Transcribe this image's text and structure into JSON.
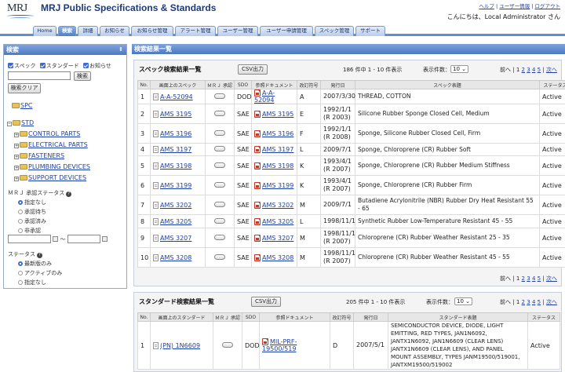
{
  "app": {
    "logo_text": "MRJ",
    "title": "MRJ Public Specifications & Standards"
  },
  "header": {
    "links": [
      "ヘルプ",
      "ユーザー情報",
      "ログアウト"
    ],
    "separator": "|",
    "greeting": "こんにちは、Local Administrator さん"
  },
  "tabs": [
    {
      "label": "Home",
      "active": false
    },
    {
      "label": "検索",
      "active": true
    },
    {
      "label": "詳細",
      "active": false
    },
    {
      "label": "お知らせ",
      "active": false
    },
    {
      "label": "お知らせ管理",
      "active": false
    },
    {
      "label": "アラート管理",
      "active": false
    },
    {
      "label": "ユーザー管理",
      "active": false
    },
    {
      "label": "ユーザー申請管理",
      "active": false
    },
    {
      "label": "スペック管理",
      "active": false
    },
    {
      "label": "サポート",
      "active": false
    }
  ],
  "sidebar": {
    "title": "検索",
    "collapse_glyph": "⇕",
    "filters": {
      "spec": "スペック",
      "standard": "スタンダード",
      "notice": "お知らせ"
    },
    "search_button": "検索",
    "clear_button": "検索クリア",
    "tree": {
      "spc": "SPC",
      "std": "STD",
      "std_children": [
        "CONTROL PARTS",
        "ELECTRICAL PARTS",
        "FASTENERS",
        "PLUMBING DEVICES",
        "SUPPORT DEVICES"
      ]
    },
    "approval_label": "ＭＲＪ 承認ステータス",
    "approval_options": [
      "指定なし",
      "承認待ち",
      "承認済み",
      "非承認"
    ],
    "approval_selected": 0,
    "range_sep": "～",
    "status_label": "ステータス",
    "status_options": [
      "最新版のみ",
      "アクティブのみ",
      "指定なし"
    ],
    "status_selected": 0,
    "help_glyph": "?"
  },
  "main": {
    "title": "検索結果一覧",
    "spec": {
      "title": "スペック検索結果一覧",
      "csv_button": "CSV出力",
      "count_text": "186 件中 1 - 10 件表示",
      "per_page_label": "表示件数：",
      "per_page": "10",
      "pager": {
        "prev": "前へ",
        "sep": "|",
        "pages": [
          "1",
          "2",
          "3",
          "4",
          "5"
        ],
        "next": "次へ"
      },
      "columns": [
        "No.",
        "画面上のスペック",
        "ＭＲＪ 承認",
        "SDO",
        "参照ドキュメント",
        "改訂符号",
        "発行日",
        "スペック表題",
        "ステータス"
      ],
      "rows": [
        {
          "no": "1",
          "spec": "A-A-52094",
          "sdo": "DOD",
          "doc": "A-A-52094",
          "rev": "A",
          "date": "2007/3/30",
          "title": "THREAD, COTTON",
          "status": "Active"
        },
        {
          "no": "2",
          "spec": "AMS 3195",
          "sdo": "SAE",
          "doc": "AMS 3195",
          "rev": "E",
          "date": "1992/1/1\n(R 2003)",
          "title": "Silicone Rubber Sponge Closed Cell, Medium",
          "status": "Active"
        },
        {
          "no": "3",
          "spec": "AMS 3196",
          "sdo": "SAE",
          "doc": "AMS 3196",
          "rev": "F",
          "date": "1992/1/1\n(R 2008)",
          "title": "Sponge, Silicone Rubber Closed Cell, Firm",
          "status": "Active"
        },
        {
          "no": "4",
          "spec": "AMS 3197",
          "sdo": "SAE",
          "doc": "AMS 3197",
          "rev": "L",
          "date": "2009/7/1",
          "title": "Sponge, Chloroprene (CR) Rubber Soft",
          "status": "Active"
        },
        {
          "no": "5",
          "spec": "AMS 3198",
          "sdo": "SAE",
          "doc": "AMS 3198",
          "rev": "K",
          "date": "1993/4/1\n(R 2007)",
          "title": "Sponge, Chloroprene (CR) Rubber Medium Stiffness",
          "status": "Active"
        },
        {
          "no": "6",
          "spec": "AMS 3199",
          "sdo": "SAE",
          "doc": "AMS 3199",
          "rev": "K",
          "date": "1993/4/1\n(R 2007)",
          "title": "Sponge, Chloroprene (CR) Rubber Firm",
          "status": "Active"
        },
        {
          "no": "7",
          "spec": "AMS 3202",
          "sdo": "SAE",
          "doc": "AMS 3202",
          "rev": "M",
          "date": "2009/7/1",
          "title": "Butadiene Acrylonitrile (NBR) Rubber Dry Heat Resistant 55 - 65",
          "status": "Active"
        },
        {
          "no": "8",
          "spec": "AMS 3205",
          "sdo": "SAE",
          "doc": "AMS 3205",
          "rev": "L",
          "date": "1998/11/1",
          "title": "Synthetic Rubber Low-Temperature Resistant 45 - 55",
          "status": "Active"
        },
        {
          "no": "9",
          "spec": "AMS 3207",
          "sdo": "SAE",
          "doc": "AMS 3207",
          "rev": "M",
          "date": "1998/11/1\n(R 2007)",
          "title": "Chloroprene (CR) Rubber Weather Resistant 25 - 35",
          "status": "Active"
        },
        {
          "no": "10",
          "spec": "AMS 3208",
          "sdo": "SAE",
          "doc": "AMS 3208",
          "rev": "M",
          "date": "1998/11/1\n(R 2007)",
          "title": "Chloroprene (CR) Rubber Weather Resistant 45 - 55",
          "status": "Active"
        }
      ]
    },
    "standard": {
      "title": "スタンダード検索結果一覧",
      "csv_button": "CSV出力",
      "count_text": "205 件中 1 - 10 件表示",
      "per_page_label": "表示件数：",
      "per_page": "10",
      "pager": {
        "prev": "前へ",
        "sep": "|",
        "pages": [
          "1",
          "2",
          "3",
          "4",
          "5"
        ],
        "next": "次へ"
      },
      "columns": [
        "No.",
        "画面上のスタンダード",
        "ＭＲＪ 承認",
        "SDO",
        "参照ドキュメント",
        "改訂符号",
        "発行日",
        "スタンダード表題",
        "ステータス"
      ],
      "rows": [
        {
          "no": "1",
          "spec": "(PN) 1N6609",
          "sdo": "DOD",
          "doc": "MIL-PRF-19500/519",
          "rev": "D",
          "date": "2007/5/1",
          "title": "SEMICONDUCTOR DEVICE, DIODE, LIGHT EMITTING, RED TYPES, JAN1N6092, JANTX1N6092, JAN1N6609 (CLEAR LENS) JANTX1N6609 (CLEAR LENS), AND PANEL MOUNT ASSEMBLY, TYPES JANM19500/519001, JANTXM19500/519002",
          "status": "Active"
        }
      ]
    }
  }
}
